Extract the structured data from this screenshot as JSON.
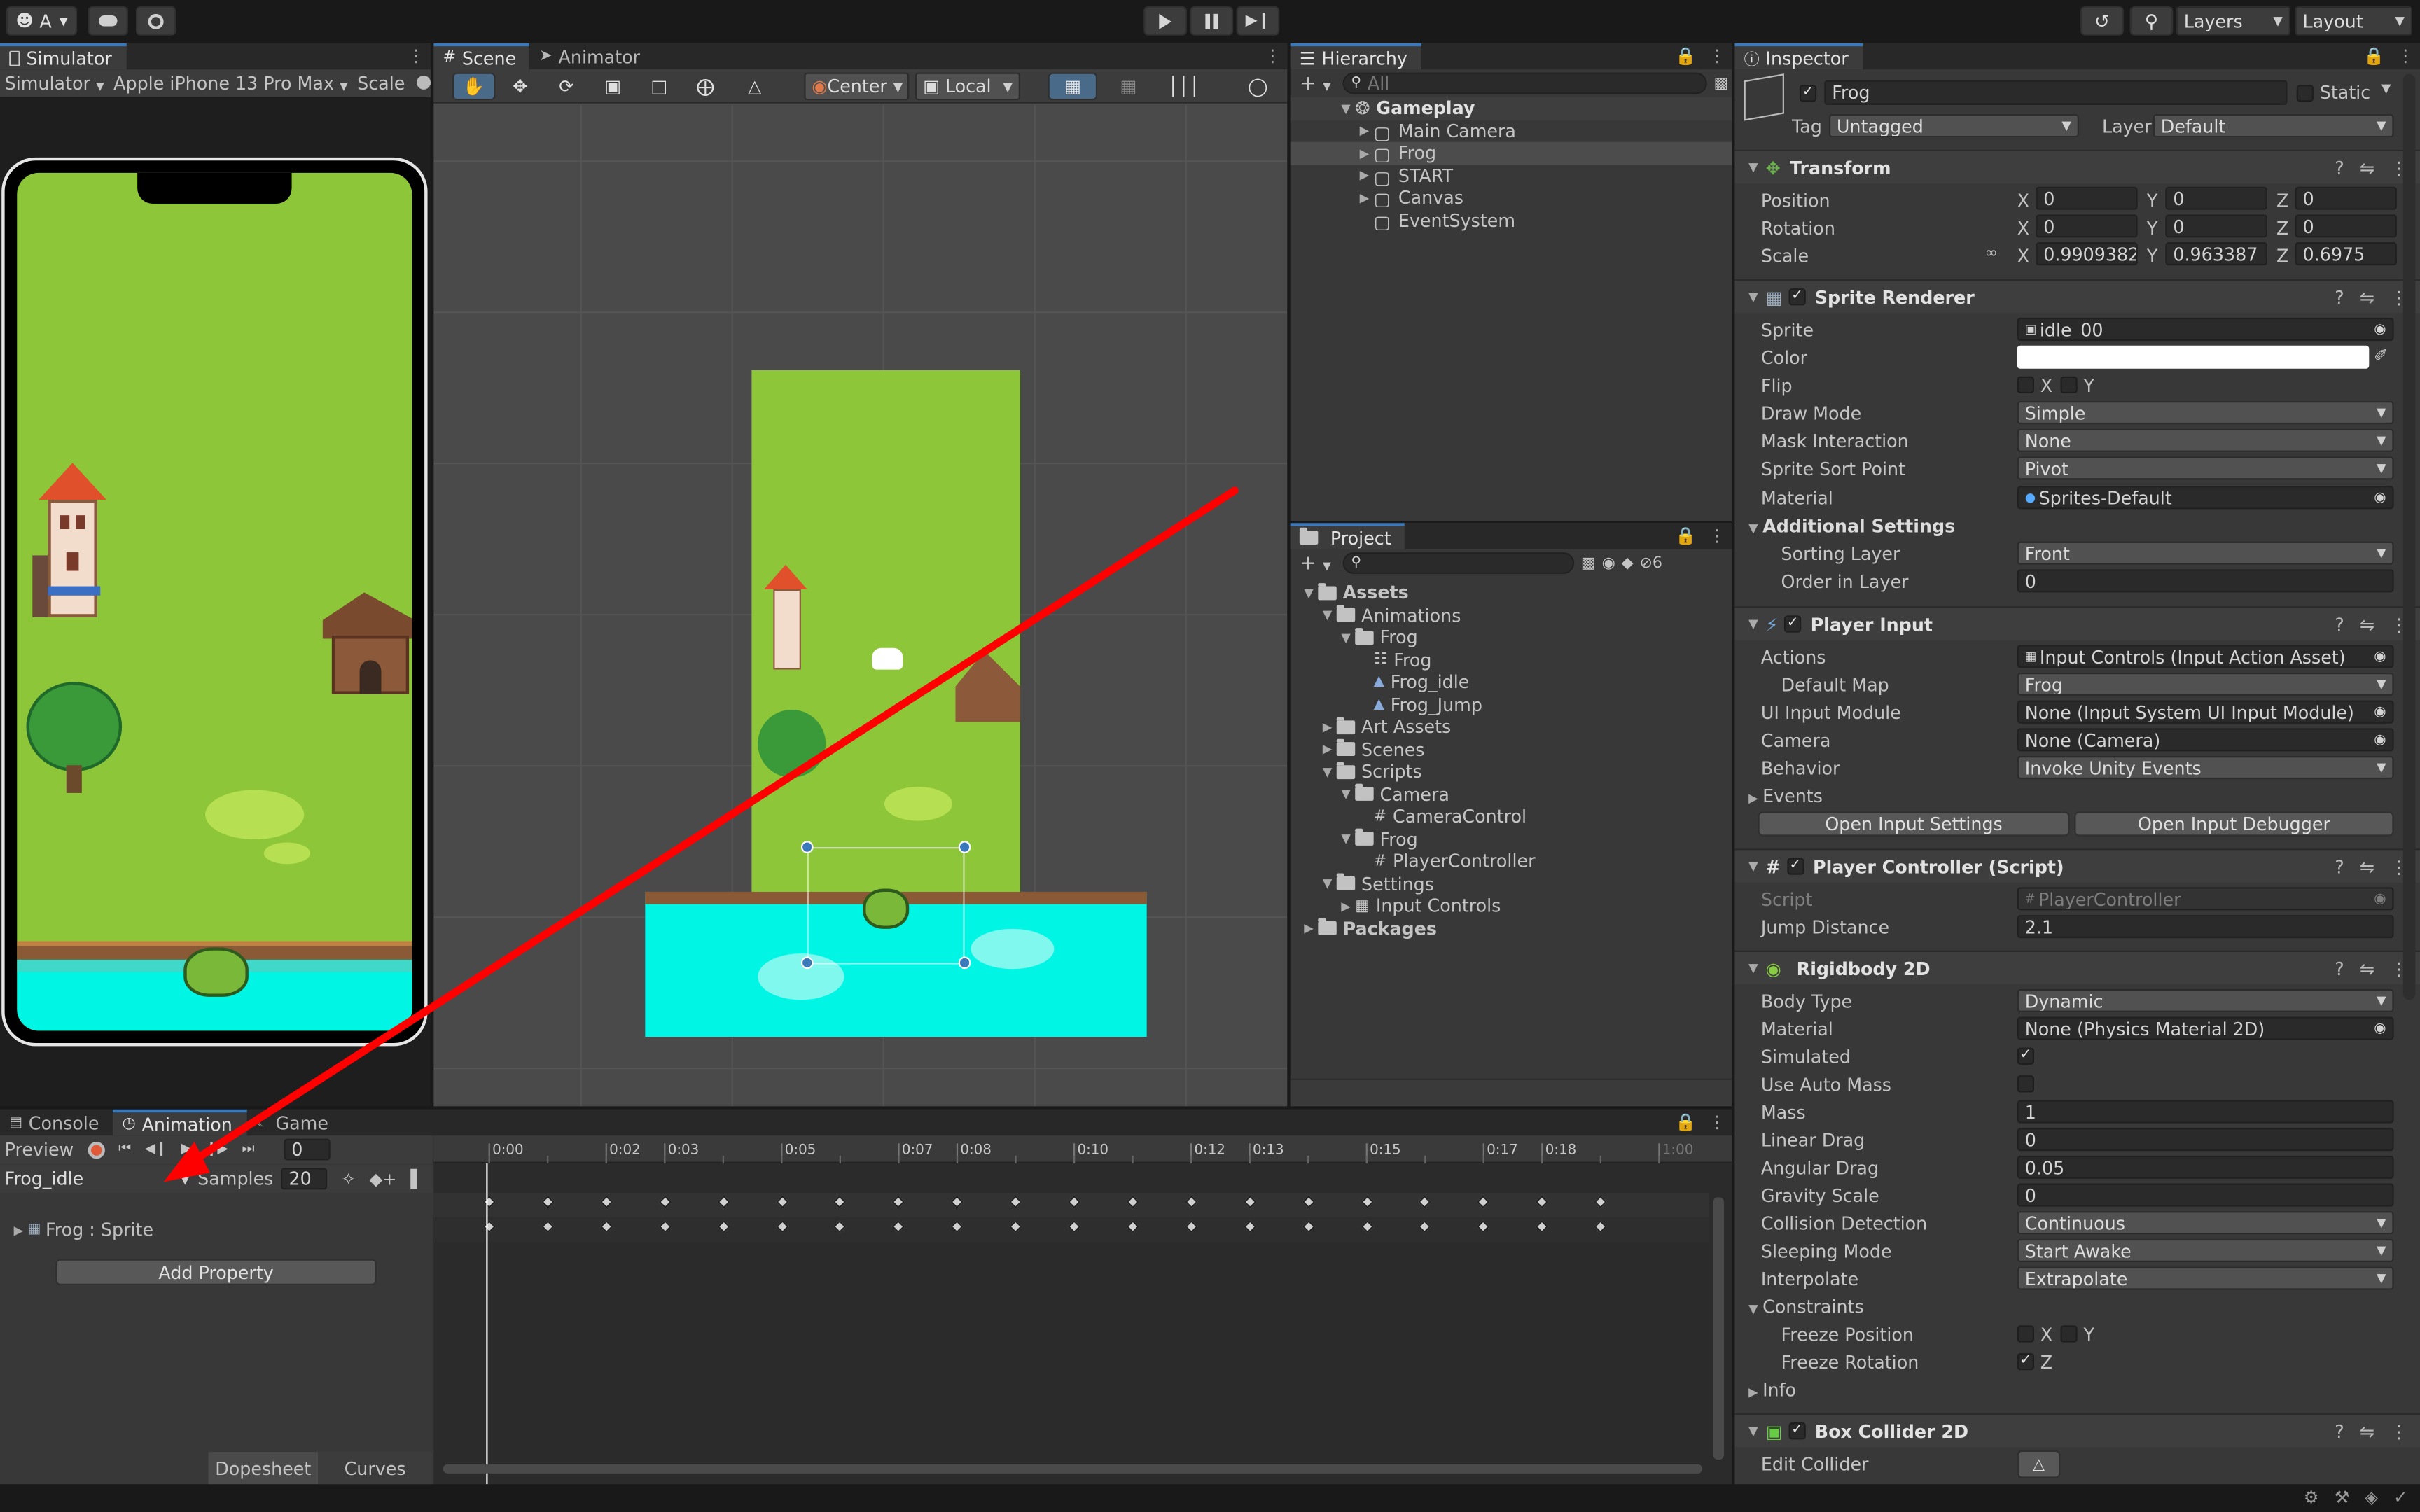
{
  "toolbar": {
    "account": "A",
    "layers": "Layers",
    "layout": "Layout"
  },
  "simulator": {
    "tab": "Simulator",
    "mode": "Simulator",
    "device": "Apple iPhone 13 Pro Max",
    "scale_label": "Scale"
  },
  "scene": {
    "tabs": [
      "Scene",
      "Animator"
    ],
    "pivot": "Center",
    "space": "Local"
  },
  "hierarchy": {
    "tab": "Hierarchy",
    "search_placeholder": "All",
    "scene_name": "Gameplay",
    "items": [
      "Main Camera",
      "Frog",
      "START",
      "Canvas",
      "EventSystem"
    ]
  },
  "project": {
    "tab": "Project",
    "hidden_count": "6",
    "tree": [
      "Assets",
      "Animations",
      "Frog",
      "Frog",
      "Frog_idle",
      "Frog_Jump",
      "Art Assets",
      "Scenes",
      "Scripts",
      "Camera",
      "CameraControl",
      "Frog",
      "PlayerController",
      "Settings",
      "Input Controls",
      "Packages"
    ]
  },
  "inspector": {
    "tab": "Inspector",
    "object_name": "Frog",
    "static_label": "Static",
    "tag_label": "Tag",
    "tag_value": "Untagged",
    "layer_label": "Layer",
    "layer_value": "Default",
    "transform": {
      "title": "Transform",
      "position_label": "Position",
      "pos": [
        "0",
        "0",
        "0"
      ],
      "rotation_label": "Rotation",
      "rot": [
        "0",
        "0",
        "0"
      ],
      "scale_label": "Scale",
      "scale": [
        "0.9909382",
        "0.963387",
        "0.6975"
      ]
    },
    "sprite_renderer": {
      "title": "Sprite Renderer",
      "sprite_label": "Sprite",
      "sprite": "idle_00",
      "color_label": "Color",
      "flip_label": "Flip",
      "draw_mode_label": "Draw Mode",
      "draw_mode": "Simple",
      "mask_label": "Mask Interaction",
      "mask": "None",
      "sort_point_label": "Sprite Sort Point",
      "sort_point": "Pivot",
      "material_label": "Material",
      "material": "Sprites-Default",
      "additional_label": "Additional Settings",
      "sorting_layer_label": "Sorting Layer",
      "sorting_layer": "Front",
      "order_label": "Order in Layer",
      "order": "0"
    },
    "player_input": {
      "title": "Player Input",
      "actions_label": "Actions",
      "actions": "Input Controls (Input Action Asset)",
      "default_map_label": "Default Map",
      "default_map": "Frog",
      "ui_module_label": "UI Input Module",
      "ui_module": "None (Input System UI Input Module)",
      "camera_label": "Camera",
      "camera": "None (Camera)",
      "behavior_label": "Behavior",
      "behavior": "Invoke Unity Events",
      "events_label": "Events",
      "open_settings": "Open Input Settings",
      "open_debugger": "Open Input Debugger"
    },
    "player_controller": {
      "title": "Player Controller (Script)",
      "script_label": "Script",
      "script": "PlayerController",
      "jump_label": "Jump Distance",
      "jump": "2.1"
    },
    "rigidbody": {
      "title": "Rigidbody 2D",
      "body_type_label": "Body Type",
      "body_type": "Dynamic",
      "material_label": "Material",
      "material": "None (Physics Material 2D)",
      "simulated_label": "Simulated",
      "auto_mass_label": "Use Auto Mass",
      "mass_label": "Mass",
      "mass": "1",
      "linear_label": "Linear Drag",
      "linear": "0",
      "angular_label": "Angular Drag",
      "angular": "0.05",
      "gravity_label": "Gravity Scale",
      "gravity": "0",
      "collision_label": "Collision Detection",
      "collision": "Continuous",
      "sleeping_label": "Sleeping Mode",
      "sleeping": "Start Awake",
      "interpolate_label": "Interpolate",
      "interpolate": "Extrapolate",
      "constraints_label": "Constraints",
      "freeze_pos_label": "Freeze Position",
      "freeze_rot_label": "Freeze Rotation",
      "info_label": "Info"
    },
    "box_collider": {
      "title": "Box Collider 2D",
      "edit_label": "Edit Collider"
    },
    "axis": {
      "x": "X",
      "y": "Y",
      "z": "Z"
    }
  },
  "animation": {
    "tabs": [
      "Console",
      "Animation",
      "Game"
    ],
    "preview": "Preview",
    "frame": "0",
    "clip": "Frog_idle",
    "samples_label": "Samples",
    "samples": "20",
    "property": "Frog : Sprite",
    "add_property": "Add Property",
    "dopesheet": "Dopesheet",
    "curves": "Curves",
    "ruler": [
      "0:00",
      "0:02",
      "0:03",
      "0:05",
      "0:07",
      "0:08",
      "0:10",
      "0:12",
      "0:13",
      "0:15",
      "0:17",
      "0:18",
      "1:00"
    ],
    "keyframe_count": 20
  },
  "colors": {
    "annotation_arrow": "#ff0000",
    "grass": "#8ec63a",
    "water": "#00f5e4",
    "accent": "#3a79bb"
  }
}
